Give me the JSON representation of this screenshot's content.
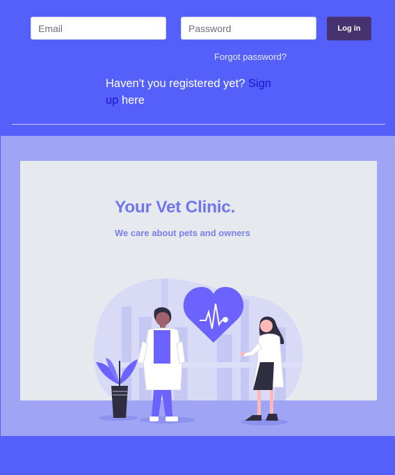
{
  "login": {
    "email_placeholder": "Email",
    "password_placeholder": "Password",
    "login_button": "Log in",
    "forgot_password": "Forgot password?",
    "register_text": "Haven't you registered yet?",
    "signup_link": "Sign up",
    "register_suffix": "here"
  },
  "hero": {
    "title": "Your Vet Clinic.",
    "subtitle": "We care about pets and owners",
    "illustration_icons": [
      "heart-pulse-icon",
      "plant-icon",
      "doctor-figure",
      "nurse-figure",
      "city-skyline"
    ]
  },
  "colors": {
    "header_bg": "#5560fb",
    "hero_bg": "#a0a4f4",
    "card_bg": "#e6e9ed",
    "accent": "#6c63ff",
    "button_bg": "#46326f",
    "link": "#1b14d6"
  }
}
